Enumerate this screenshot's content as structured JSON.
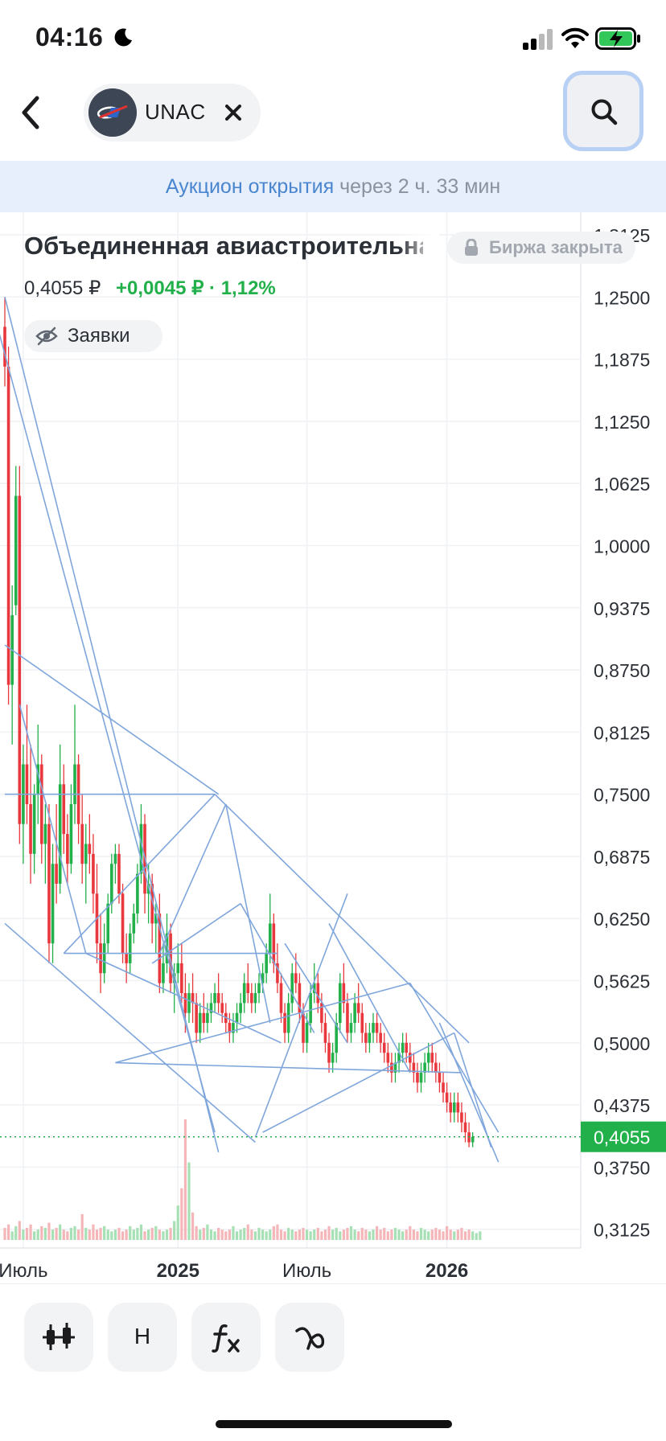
{
  "status": {
    "time": "04:16"
  },
  "header": {
    "ticker": "UNAC"
  },
  "banner": {
    "highlight": "Аукцион открытия",
    "rest": "через 2 ч. 33 мин"
  },
  "instrument": {
    "name": "Объединенная авиастроительная корпорация",
    "exchange_status": "Биржа закрыта",
    "price": "0,4055 ₽",
    "change": "+0,0045 ₽ · 1,12%",
    "orders_label": "Заявки"
  },
  "toolbar": {
    "indicator_label": "H"
  },
  "colors": {
    "up": "#21b04a",
    "down": "#e8383d",
    "trendline": "#7fa6db",
    "price_badge": "#21b04a",
    "banner_bg": "#e6effb"
  },
  "chart_data": {
    "type": "candlestick",
    "y_axis_ticks": [
      "1,3125",
      "1,2500",
      "1,1875",
      "1,1250",
      "1,0625",
      "1,0000",
      "0,9375",
      "0,8750",
      "0,8125",
      "0,7500",
      "0,6875",
      "0,6250",
      "0,5625",
      "0,5000",
      "0,4375",
      "0,3750",
      "0,3125"
    ],
    "y_range": [
      0.305,
      1.3125
    ],
    "x_labels": [
      {
        "label": "Июль",
        "bold": false,
        "candle_index": 5
      },
      {
        "label": "2025",
        "bold": true,
        "candle_index": 47
      },
      {
        "label": "Июль",
        "bold": false,
        "candle_index": 82
      },
      {
        "label": "2026",
        "bold": true,
        "candle_index": 120
      }
    ],
    "current_price": 0.4055,
    "current_price_label": "0,4055",
    "candles": [
      [
        1.22,
        1.25,
        1.16,
        1.18
      ],
      [
        1.18,
        1.2,
        0.84,
        0.86
      ],
      [
        0.86,
        0.96,
        0.8,
        0.93
      ],
      [
        0.94,
        1.08,
        0.93,
        1.05
      ],
      [
        1.05,
        1.08,
        0.7,
        0.72
      ],
      [
        0.72,
        0.8,
        0.68,
        0.78
      ],
      [
        0.78,
        0.84,
        0.72,
        0.74
      ],
      [
        0.74,
        0.8,
        0.66,
        0.69
      ],
      [
        0.69,
        0.76,
        0.67,
        0.75
      ],
      [
        0.75,
        0.82,
        0.72,
        0.78
      ],
      [
        0.78,
        0.79,
        0.68,
        0.7
      ],
      [
        0.7,
        0.74,
        0.66,
        0.72
      ],
      [
        0.72,
        0.74,
        0.58,
        0.6
      ],
      [
        0.6,
        0.7,
        0.58,
        0.68
      ],
      [
        0.68,
        0.74,
        0.64,
        0.66
      ],
      [
        0.66,
        0.8,
        0.65,
        0.76
      ],
      [
        0.76,
        0.78,
        0.69,
        0.71
      ],
      [
        0.71,
        0.73,
        0.66,
        0.68
      ],
      [
        0.68,
        0.76,
        0.67,
        0.74
      ],
      [
        0.74,
        0.84,
        0.72,
        0.78
      ],
      [
        0.78,
        0.79,
        0.7,
        0.72
      ],
      [
        0.72,
        0.75,
        0.66,
        0.68
      ],
      [
        0.68,
        0.72,
        0.64,
        0.7
      ],
      [
        0.7,
        0.73,
        0.67,
        0.69
      ],
      [
        0.69,
        0.71,
        0.63,
        0.65
      ],
      [
        0.65,
        0.68,
        0.58,
        0.6
      ],
      [
        0.6,
        0.63,
        0.55,
        0.57
      ],
      [
        0.57,
        0.62,
        0.56,
        0.6
      ],
      [
        0.6,
        0.65,
        0.59,
        0.64
      ],
      [
        0.64,
        0.69,
        0.63,
        0.68
      ],
      [
        0.68,
        0.7,
        0.66,
        0.69
      ],
      [
        0.69,
        0.7,
        0.64,
        0.65
      ],
      [
        0.65,
        0.66,
        0.58,
        0.59
      ],
      [
        0.59,
        0.61,
        0.56,
        0.58
      ],
      [
        0.58,
        0.62,
        0.57,
        0.61
      ],
      [
        0.61,
        0.64,
        0.6,
        0.63
      ],
      [
        0.63,
        0.68,
        0.62,
        0.67
      ],
      [
        0.67,
        0.74,
        0.66,
        0.72
      ],
      [
        0.72,
        0.73,
        0.63,
        0.65
      ],
      [
        0.65,
        0.68,
        0.62,
        0.66
      ],
      [
        0.66,
        0.67,
        0.6,
        0.62
      ],
      [
        0.62,
        0.64,
        0.59,
        0.63
      ],
      [
        0.63,
        0.65,
        0.55,
        0.56
      ],
      [
        0.56,
        0.6,
        0.55,
        0.58
      ],
      [
        0.58,
        0.63,
        0.57,
        0.61
      ],
      [
        0.61,
        0.62,
        0.55,
        0.56
      ],
      [
        0.56,
        0.58,
        0.53,
        0.57
      ],
      [
        0.57,
        0.6,
        0.56,
        0.58
      ],
      [
        0.58,
        0.6,
        0.54,
        0.55
      ],
      [
        0.55,
        0.57,
        0.51,
        0.53
      ],
      [
        0.53,
        0.56,
        0.52,
        0.55
      ],
      [
        0.55,
        0.57,
        0.52,
        0.54
      ],
      [
        0.54,
        0.55,
        0.5,
        0.51
      ],
      [
        0.51,
        0.54,
        0.5,
        0.53
      ],
      [
        0.53,
        0.55,
        0.51,
        0.52
      ],
      [
        0.52,
        0.54,
        0.51,
        0.53
      ],
      [
        0.53,
        0.55,
        0.52,
        0.54
      ],
      [
        0.54,
        0.56,
        0.53,
        0.55
      ],
      [
        0.55,
        0.57,
        0.53,
        0.54
      ],
      [
        0.54,
        0.55,
        0.52,
        0.53
      ],
      [
        0.53,
        0.54,
        0.51,
        0.52
      ],
      [
        0.52,
        0.53,
        0.5,
        0.51
      ],
      [
        0.51,
        0.53,
        0.5,
        0.52
      ],
      [
        0.52,
        0.54,
        0.51,
        0.53
      ],
      [
        0.53,
        0.55,
        0.52,
        0.54
      ],
      [
        0.54,
        0.57,
        0.53,
        0.56
      ],
      [
        0.56,
        0.58,
        0.54,
        0.55
      ],
      [
        0.55,
        0.56,
        0.53,
        0.54
      ],
      [
        0.54,
        0.56,
        0.53,
        0.55
      ],
      [
        0.55,
        0.57,
        0.54,
        0.56
      ],
      [
        0.56,
        0.58,
        0.55,
        0.57
      ],
      [
        0.57,
        0.6,
        0.56,
        0.59
      ],
      [
        0.59,
        0.65,
        0.58,
        0.62
      ],
      [
        0.62,
        0.63,
        0.57,
        0.58
      ],
      [
        0.58,
        0.6,
        0.55,
        0.56
      ],
      [
        0.56,
        0.57,
        0.52,
        0.53
      ],
      [
        0.53,
        0.54,
        0.5,
        0.51
      ],
      [
        0.51,
        0.55,
        0.5,
        0.54
      ],
      [
        0.54,
        0.58,
        0.53,
        0.57
      ],
      [
        0.57,
        0.59,
        0.55,
        0.56
      ],
      [
        0.56,
        0.57,
        0.52,
        0.53
      ],
      [
        0.53,
        0.54,
        0.49,
        0.5
      ],
      [
        0.5,
        0.53,
        0.49,
        0.52
      ],
      [
        0.52,
        0.56,
        0.51,
        0.55
      ],
      [
        0.55,
        0.58,
        0.54,
        0.56
      ],
      [
        0.56,
        0.57,
        0.53,
        0.54
      ],
      [
        0.54,
        0.55,
        0.51,
        0.52
      ],
      [
        0.52,
        0.53,
        0.49,
        0.5
      ],
      [
        0.5,
        0.51,
        0.47,
        0.48
      ],
      [
        0.48,
        0.5,
        0.47,
        0.49
      ],
      [
        0.49,
        0.53,
        0.48,
        0.52
      ],
      [
        0.52,
        0.57,
        0.51,
        0.56
      ],
      [
        0.56,
        0.58,
        0.53,
        0.54
      ],
      [
        0.54,
        0.55,
        0.5,
        0.51
      ],
      [
        0.51,
        0.53,
        0.5,
        0.52
      ],
      [
        0.52,
        0.55,
        0.51,
        0.54
      ],
      [
        0.54,
        0.56,
        0.52,
        0.53
      ],
      [
        0.53,
        0.54,
        0.5,
        0.51
      ],
      [
        0.51,
        0.52,
        0.49,
        0.5
      ],
      [
        0.5,
        0.52,
        0.49,
        0.51
      ],
      [
        0.51,
        0.53,
        0.5,
        0.52
      ],
      [
        0.52,
        0.53,
        0.5,
        0.51
      ],
      [
        0.51,
        0.52,
        0.49,
        0.5
      ],
      [
        0.5,
        0.51,
        0.48,
        0.49
      ],
      [
        0.49,
        0.5,
        0.47,
        0.48
      ],
      [
        0.48,
        0.49,
        0.46,
        0.47
      ],
      [
        0.47,
        0.49,
        0.46,
        0.48
      ],
      [
        0.48,
        0.5,
        0.47,
        0.49
      ],
      [
        0.49,
        0.51,
        0.48,
        0.5
      ],
      [
        0.5,
        0.51,
        0.48,
        0.49
      ],
      [
        0.49,
        0.5,
        0.47,
        0.48
      ],
      [
        0.48,
        0.49,
        0.46,
        0.47
      ],
      [
        0.47,
        0.48,
        0.45,
        0.46
      ],
      [
        0.46,
        0.48,
        0.45,
        0.47
      ],
      [
        0.47,
        0.49,
        0.46,
        0.48
      ],
      [
        0.48,
        0.5,
        0.47,
        0.49
      ],
      [
        0.49,
        0.5,
        0.47,
        0.48
      ],
      [
        0.48,
        0.49,
        0.46,
        0.47
      ],
      [
        0.47,
        0.48,
        0.45,
        0.46
      ],
      [
        0.46,
        0.47,
        0.44,
        0.45
      ],
      [
        0.45,
        0.46,
        0.43,
        0.44
      ],
      [
        0.44,
        0.45,
        0.42,
        0.43
      ],
      [
        0.43,
        0.45,
        0.42,
        0.44
      ],
      [
        0.44,
        0.45,
        0.42,
        0.43
      ],
      [
        0.43,
        0.44,
        0.41,
        0.42
      ],
      [
        0.42,
        0.43,
        0.4,
        0.41
      ],
      [
        0.41,
        0.42,
        0.395,
        0.4
      ],
      [
        0.4,
        0.41,
        0.395,
        0.4055
      ]
    ],
    "volumes": [
      14,
      18,
      10,
      16,
      22,
      12,
      14,
      18,
      10,
      12,
      16,
      14,
      20,
      12,
      14,
      18,
      12,
      10,
      14,
      16,
      12,
      30,
      14,
      12,
      18,
      12,
      14,
      16,
      12,
      10,
      12,
      14,
      10,
      12,
      16,
      12,
      14,
      18,
      10,
      12,
      14,
      16,
      12,
      10,
      12,
      14,
      22,
      40,
      60,
      140,
      90,
      32,
      16,
      12,
      14,
      18,
      12,
      10,
      14,
      12,
      10,
      12,
      16,
      10,
      12,
      14,
      18,
      12,
      10,
      14,
      12,
      10,
      12,
      16,
      18,
      12,
      10,
      14,
      12,
      10,
      12,
      14,
      12,
      10,
      12,
      14,
      10,
      12,
      16,
      12,
      14,
      10,
      12,
      14,
      16,
      12,
      10,
      14,
      12,
      10,
      12,
      16,
      12,
      14,
      10,
      12,
      14,
      12,
      10,
      12,
      16,
      12,
      10,
      14,
      12,
      10,
      12,
      14,
      12,
      10,
      16,
      12,
      10,
      12,
      14,
      10,
      12,
      10,
      8,
      10
    ],
    "trendlines": [
      {
        "from": [
          0,
          1.25
        ],
        "to": [
          58,
          0.39
        ]
      },
      {
        "from": [
          -2,
          1.22
        ],
        "to": [
          57,
          0.41
        ]
      },
      {
        "from": [
          0,
          0.9
        ],
        "to": [
          58,
          0.75
        ]
      },
      {
        "from": [
          57,
          0.75
        ],
        "to": [
          126,
          0.5
        ]
      },
      {
        "from": [
          16,
          0.59
        ],
        "to": [
          57,
          0.75
        ]
      },
      {
        "from": [
          16,
          0.59
        ],
        "to": [
          74,
          0.59
        ]
      },
      {
        "from": [
          0,
          0.75
        ],
        "to": [
          57,
          0.75
        ]
      },
      {
        "from": [
          4,
          0.84
        ],
        "to": [
          22,
          0.59
        ]
      },
      {
        "from": [
          22,
          0.59
        ],
        "to": [
          75,
          0.5
        ]
      },
      {
        "from": [
          0,
          0.62
        ],
        "to": [
          68,
          0.4
        ]
      },
      {
        "from": [
          30,
          0.48
        ],
        "to": [
          124,
          0.47
        ]
      },
      {
        "from": [
          30,
          0.48
        ],
        "to": [
          110,
          0.56
        ]
      },
      {
        "from": [
          68,
          0.405
        ],
        "to": [
          93,
          0.65
        ]
      },
      {
        "from": [
          70,
          0.41
        ],
        "to": [
          122,
          0.51
        ]
      },
      {
        "from": [
          40,
          0.58
        ],
        "to": [
          64,
          0.64
        ]
      },
      {
        "from": [
          42,
          0.59
        ],
        "to": [
          60,
          0.74
        ]
      },
      {
        "from": [
          60,
          0.74
        ],
        "to": [
          72,
          0.52
        ]
      },
      {
        "from": [
          110,
          0.56
        ],
        "to": [
          134,
          0.41
        ]
      },
      {
        "from": [
          118,
          0.52
        ],
        "to": [
          134,
          0.38
        ]
      },
      {
        "from": [
          122,
          0.51
        ],
        "to": [
          132,
          0.395
        ]
      },
      {
        "from": [
          88,
          0.62
        ],
        "to": [
          110,
          0.47
        ]
      },
      {
        "from": [
          64,
          0.64
        ],
        "to": [
          84,
          0.51
        ]
      },
      {
        "from": [
          76,
          0.6
        ],
        "to": [
          93,
          0.5
        ]
      }
    ]
  }
}
